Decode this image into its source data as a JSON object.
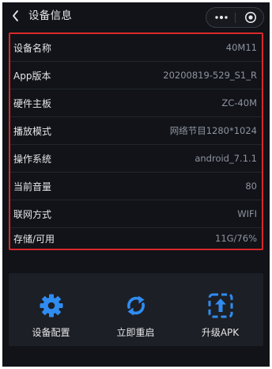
{
  "header": {
    "title": "设备信息",
    "back_icon": "chevron-left-icon",
    "more_icon": "more-dots-icon",
    "close_icon": "target-close-icon"
  },
  "device_info": [
    {
      "label": "设备名称",
      "value": "40M11"
    },
    {
      "label": "App版本",
      "value": "20200819-529_S1_R"
    },
    {
      "label": "硬件主板",
      "value": "ZC-40M"
    },
    {
      "label": "播放模式",
      "value": "网络节目1280*1024"
    },
    {
      "label": "操作系统",
      "value": "android_7.1.1"
    },
    {
      "label": "当前音量",
      "value": "80"
    },
    {
      "label": "联网方式",
      "value": "WIFI"
    },
    {
      "label": "存储/可用",
      "value": "11G/76%"
    }
  ],
  "actions": [
    {
      "label": "设备配置",
      "icon": "gear-icon"
    },
    {
      "label": "立即重启",
      "icon": "refresh-icon"
    },
    {
      "label": "升级APK",
      "icon": "upload-icon"
    }
  ],
  "colors": {
    "background": "#111318",
    "panel": "#1c1f26",
    "highlight_border": "#d8282a",
    "icon_blue": "#2f8cf0",
    "label_text": "#e6e6e8",
    "value_text": "#8f94a0"
  }
}
